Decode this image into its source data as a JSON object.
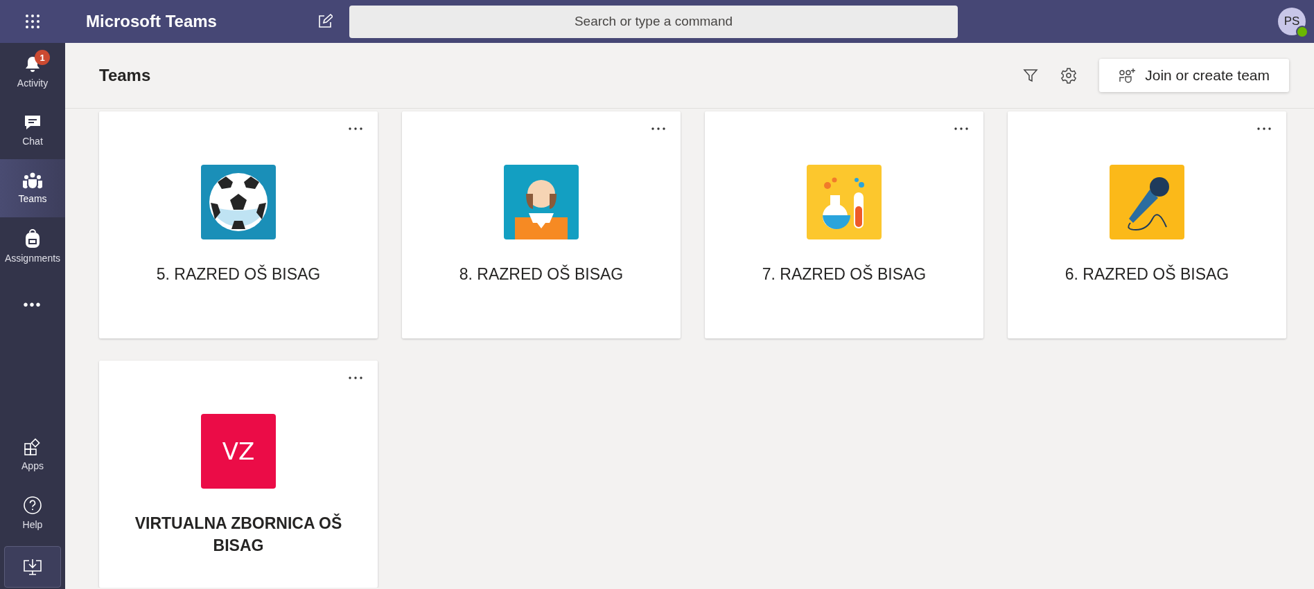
{
  "top_bar": {
    "title": "Microsoft Teams",
    "search": {
      "placeholder": "Search or type a command"
    },
    "avatar": {
      "initials": "PS",
      "online": true
    }
  },
  "rail": {
    "items": [
      {
        "kind": "activity",
        "label": "Activity",
        "badge": "1",
        "selected": false
      },
      {
        "kind": "chat",
        "label": "Chat",
        "selected": false
      },
      {
        "kind": "teams",
        "label": "Teams",
        "selected": true
      },
      {
        "kind": "assignments",
        "label": "Assignments",
        "selected": false
      },
      {
        "kind": "more",
        "label": "•••",
        "selected": false
      }
    ],
    "bottom_items": [
      {
        "kind": "apps",
        "label": "Apps"
      },
      {
        "kind": "help",
        "label": "Help"
      }
    ]
  },
  "header": {
    "title": "Teams",
    "join_button": "Join or create team"
  },
  "teams": [
    {
      "name": "5. RAZRED OŠ BISAG",
      "kind": "soccer",
      "color": "#1a8fb8",
      "unread": false
    },
    {
      "name": "8. RAZRED OŠ BISAG",
      "kind": "person",
      "color": "#139fc2",
      "unread": false
    },
    {
      "name": "7. RAZRED OŠ BISAG",
      "kind": "flask",
      "color": "#fcc72d",
      "unread": false
    },
    {
      "name": "6. RAZRED OŠ BISAG",
      "kind": "microphone",
      "color": "#fbb919",
      "unread": false
    },
    {
      "name": "VIRTUALNA ZBORNICA OŠ BISAG",
      "kind": "initials",
      "initials": "VZ",
      "color": "#eb0c47",
      "unread": true
    }
  ]
}
